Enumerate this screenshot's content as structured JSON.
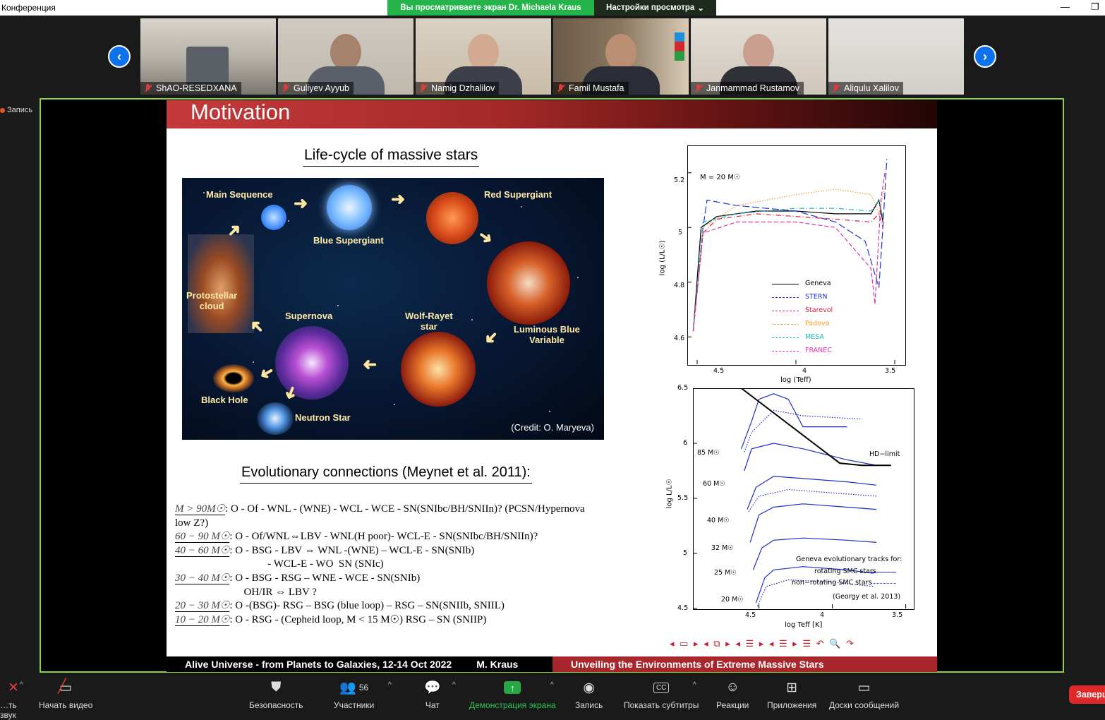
{
  "app": {
    "title": "Конференция",
    "share_banner": "Вы просматриваете экран Dr. Michaela Kraus",
    "view_settings": "Настройки просмотра"
  },
  "participants": [
    {
      "name": "ShAO-RESEDXANA"
    },
    {
      "name": "Guliyev Ayyub"
    },
    {
      "name": "Namig Dzhalilov"
    },
    {
      "name": "Famil Mustafa"
    },
    {
      "name": "Janmammad Rustamov"
    },
    {
      "name": "Aliqulu Xalilov"
    }
  ],
  "recording_label": "Запись",
  "slide": {
    "title": "Motivation",
    "lifecycle_title": "Life-cycle of massive stars",
    "lifecycle_labels": {
      "main_sequence": "Main Sequence",
      "blue_supergiant": "Blue Supergiant",
      "red_supergiant": "Red Supergiant",
      "protostellar_1": "Protostellar",
      "protostellar_2": "cloud",
      "supernova": "Supernova",
      "wolf_rayet_1": "Wolf-Rayet",
      "wolf_rayet_2": "star",
      "lbv_1": "Luminous Blue",
      "lbv_2": "Variable",
      "black_hole": "Black Hole",
      "neutron_star": "Neutron Star",
      "credit": "(Credit: O. Maryeva)"
    },
    "evolution_title": "Evolutionary connections (Meynet et al. 2011):",
    "evolution_lines": [
      {
        "mass": "M > 90M☉",
        "text": ": O - Of - WNL - (WNE) - WCL - WCE - SN(SNIbc/BH/SNIIn)?  (PCSN/Hypernova"
      },
      {
        "mass": "",
        "text": "low Z?)"
      },
      {
        "mass": "60 − 90 M☉",
        "text": ": O - Of/WNL⇔LBV - WNL(H poor)- WCL-E - SN(SNIbc/BH/SNIIn)?"
      },
      {
        "mass": "40 − 60 M☉",
        "text": ": O - BSG - LBV ⇔ WNL -(WNE) – WCL-E - SN(SNIb)"
      },
      {
        "mass": "",
        "text": "                                   - WCL-E - WO  SN (SNIc)"
      },
      {
        "mass": "30 − 40 M☉",
        "text": ": O - BSG - RSG – WNE - WCE - SN(SNIb)"
      },
      {
        "mass": "",
        "text": "                          OH/IR ⇔ LBV ?"
      },
      {
        "mass": "20 − 30 M☉",
        "text": ": O -(BSG)- RSG – BSG (blue loop) – RSG – SN(SNIIb, SNIIL)"
      },
      {
        "mass": "10 − 20 M☉",
        "text": ": O - RSG - (Cepheid loop, M < 15 M☉)  RSG – SN (SNIIP)"
      }
    ],
    "footer_left": "Alive Universe - from Planets to Galaxies, 12-14 Oct 2022",
    "footer_author": "M. Kraus",
    "footer_right": "Unveiling the Environments of Extreme Massive Stars",
    "nav_icons": "◂ ▭ ▸  ◂ ⧉ ▸  ◂ ☰ ▸  ◂ ☰ ▸   ☰   ↶ 🔍 ↷"
  },
  "chart_data": [
    {
      "type": "line",
      "xlabel": "log (Teff)",
      "ylabel": "log (L/L☉)",
      "annotation": "M = 20 M☉",
      "xlim": [
        4.55,
        3.45
      ],
      "ylim": [
        4.5,
        5.3
      ],
      "xticks": [
        "4.5",
        "4",
        "3.5"
      ],
      "yticks": [
        "5.2",
        "5",
        "4.8",
        "4.6"
      ],
      "legend": "bottom-left",
      "series": [
        {
          "name": "Geneva",
          "color": "#000000",
          "dash": "solid",
          "x": [
            4.52,
            4.48,
            4.4,
            4.2,
            4.0,
            3.8,
            3.62,
            3.58,
            3.56
          ],
          "y": [
            4.62,
            5.0,
            5.04,
            5.06,
            5.06,
            5.05,
            5.05,
            5.1,
            5.02
          ]
        },
        {
          "name": "STERN",
          "color": "#2233dd",
          "dash": "longdash",
          "x": [
            4.52,
            4.47,
            4.45,
            4.3,
            4.0,
            3.8,
            3.65,
            3.58,
            3.56,
            3.54
          ],
          "y": [
            4.62,
            5.0,
            5.1,
            5.08,
            5.06,
            5.02,
            4.95,
            4.78,
            5.0,
            5.25
          ]
        },
        {
          "name": "Starevol",
          "color": "#dd2244",
          "dash": "dashdot",
          "x": [
            4.52,
            4.47,
            4.4,
            4.2,
            4.0,
            3.8,
            3.62,
            3.58,
            3.56
          ],
          "y": [
            4.62,
            4.98,
            5.03,
            5.05,
            5.04,
            5.03,
            5.02,
            5.05,
            5.0
          ]
        },
        {
          "name": "Padova",
          "color": "#f0a020",
          "dash": "dotted",
          "x": [
            4.52,
            4.47,
            4.3,
            4.0,
            3.8,
            3.62,
            3.58,
            3.55
          ],
          "y": [
            4.62,
            5.0,
            5.08,
            5.12,
            5.14,
            5.12,
            5.05,
            5.15
          ]
        },
        {
          "name": "MESA",
          "color": "#20b8c0",
          "dash": "dashdot",
          "x": [
            4.52,
            4.47,
            4.3,
            4.0,
            3.8,
            3.62,
            3.58,
            3.56
          ],
          "y": [
            4.62,
            5.02,
            5.05,
            5.07,
            5.07,
            5.06,
            5.1,
            5.04
          ]
        },
        {
          "name": "FRANEC",
          "color": "#dd33aa",
          "dash": "dashed",
          "x": [
            4.52,
            4.47,
            4.3,
            4.0,
            3.8,
            3.62,
            3.6,
            3.57,
            3.55
          ],
          "y": [
            4.62,
            4.98,
            5.02,
            5.02,
            5.0,
            4.85,
            4.72,
            5.1,
            5.2
          ]
        }
      ]
    },
    {
      "type": "line",
      "xlabel": "log Teff [K]",
      "ylabel": "log L/L☉",
      "xlim": [
        4.95,
        3.45
      ],
      "ylim": [
        4.5,
        6.5
      ],
      "xticks": [
        "4.5",
        "4",
        "3.5"
      ],
      "yticks": [
        "6.5",
        "6",
        "5.5",
        "5",
        "4.5"
      ],
      "annotations": [
        "HD−limit",
        "(Georgy et al. 2013)",
        "Geneva evolutionary tracks for:",
        "rotating SMC stars",
        "non−rotating SMC stars"
      ],
      "mass_labels": [
        "85 M☉",
        "60 M☉",
        "40 M☉",
        "32 M☉",
        "25 M☉",
        "20 M☉"
      ],
      "legend": "bottom-right",
      "series": [
        {
          "name": "rotating SMC stars",
          "color": "#1a2fcc",
          "dash": "solid",
          "mass": "85 M☉",
          "x": [
            4.62,
            4.55,
            4.5,
            4.4,
            4.3,
            4.2,
            3.9
          ],
          "y": [
            5.95,
            6.2,
            6.4,
            6.45,
            6.4,
            6.15,
            6.15
          ]
        },
        {
          "name": "rotating SMC stars",
          "color": "#1a2fcc",
          "dash": "solid",
          "mass": "60 M☉",
          "x": [
            4.6,
            4.55,
            4.4,
            4.2,
            3.9,
            3.7
          ],
          "y": [
            5.75,
            5.95,
            6.0,
            5.95,
            5.85,
            5.8
          ]
        },
        {
          "name": "rotating SMC stars",
          "color": "#1a2fcc",
          "dash": "solid",
          "mass": "40 M☉",
          "x": [
            4.58,
            4.52,
            4.4,
            4.2,
            3.9,
            3.7
          ],
          "y": [
            5.4,
            5.6,
            5.7,
            5.68,
            5.65,
            5.62
          ]
        },
        {
          "name": "rotating SMC stars",
          "color": "#1a2fcc",
          "dash": "solid",
          "mass": "32 M☉",
          "x": [
            4.56,
            4.5,
            4.4,
            4.2,
            3.9,
            3.7
          ],
          "y": [
            5.1,
            5.35,
            5.42,
            5.45,
            5.42,
            5.4
          ]
        },
        {
          "name": "rotating SMC stars",
          "color": "#1a2fcc",
          "dash": "solid",
          "mass": "25 M☉",
          "x": [
            4.54,
            4.48,
            4.4,
            4.2,
            3.9,
            3.7
          ],
          "y": [
            4.85,
            5.05,
            5.12,
            5.14,
            5.12,
            5.1
          ]
        },
        {
          "name": "rotating SMC stars",
          "color": "#1a2fcc",
          "dash": "solid",
          "mass": "20 M☉",
          "x": [
            4.52,
            4.46,
            4.4,
            4.2,
            3.9,
            3.72
          ],
          "y": [
            4.55,
            4.78,
            4.85,
            4.88,
            4.85,
            4.82
          ]
        },
        {
          "name": "non−rotating SMC stars",
          "color": "#1a2fcc",
          "dash": "dotted",
          "mass": "85 M☉",
          "x": [
            4.6,
            4.55,
            4.4,
            4.2,
            3.8
          ],
          "y": [
            5.92,
            6.1,
            6.3,
            6.25,
            6.22
          ]
        },
        {
          "name": "non−rotating SMC stars",
          "color": "#1a2fcc",
          "dash": "dotted",
          "mass": "40 M☉",
          "x": [
            4.57,
            4.5,
            4.3,
            4.0,
            3.7
          ],
          "y": [
            5.38,
            5.52,
            5.58,
            5.55,
            5.52
          ]
        },
        {
          "name": "non−rotating SMC stars",
          "color": "#1a2fcc",
          "dash": "dotted",
          "mass": "20 M☉",
          "x": [
            4.51,
            4.45,
            4.3,
            4.0,
            3.72
          ],
          "y": [
            4.52,
            4.7,
            4.76,
            4.74,
            4.7
          ]
        },
        {
          "name": "HD−limit",
          "color": "#000000",
          "dash": "solid",
          "x": [
            4.62,
            3.95,
            3.8,
            3.6
          ],
          "y": [
            6.5,
            5.82,
            5.8,
            5.8
          ]
        }
      ]
    }
  ],
  "toolbar": {
    "items": [
      {
        "label": "…ть звук",
        "icon": "microphone-icon"
      },
      {
        "label": "Начать видео",
        "icon": "video-off-icon"
      },
      {
        "label": "Безопасность",
        "icon": "shield-icon"
      },
      {
        "label": "Участники",
        "icon": "participants-icon",
        "count": "56"
      },
      {
        "label": "Чат",
        "icon": "chat-icon"
      },
      {
        "label": "Демонстрация экрана",
        "icon": "share-screen-icon"
      },
      {
        "label": "Запись",
        "icon": "record-icon"
      },
      {
        "label": "Показать субтитры",
        "icon": "cc-icon",
        "badge": "CC"
      },
      {
        "label": "Реакции",
        "icon": "reaction-icon"
      },
      {
        "label": "Приложения",
        "icon": "apps-icon"
      },
      {
        "label": "Доски сообщений",
        "icon": "whiteboard-icon"
      }
    ],
    "end_label": "Заверш",
    "share_color": "#28c456"
  }
}
